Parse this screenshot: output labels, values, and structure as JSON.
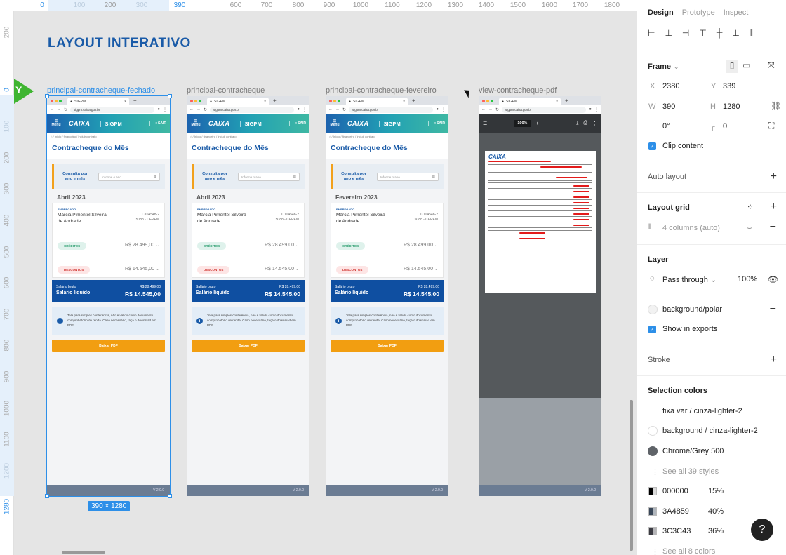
{
  "ruler": {
    "top": [
      "0",
      "100",
      "200",
      "300",
      "390",
      "600",
      "700",
      "800",
      "900",
      "1000",
      "1100",
      "1200",
      "1300",
      "1400",
      "1500",
      "1600",
      "1700",
      "1800"
    ],
    "left": [
      "200",
      "0",
      "100",
      "200",
      "300",
      "400",
      "500",
      "600",
      "700",
      "800",
      "900",
      "1000",
      "1100",
      "1200",
      "1280"
    ]
  },
  "canvas": {
    "title": "LAYOUT INTERATIVO",
    "flag_letter": "Y",
    "size_badge": "390 × 1280"
  },
  "frames": [
    {
      "label": "principal-contracheque-fechado",
      "month": "Abril 2023"
    },
    {
      "label": "principal-contracheque",
      "month": "Abril 2023"
    },
    {
      "label": "principal-contracheque-fevereiro",
      "month": "Fevereiro 2023"
    }
  ],
  "pdf_frame": {
    "label": "view-contracheque-pdf",
    "zoom": "100%",
    "logo": "CAIXA"
  },
  "mobile": {
    "tab_title": "SIGPM",
    "url": "sigpm.caixa.gov.br",
    "menu": "Menu",
    "brand": "CAIXA",
    "app": "SIGPM",
    "logout": "SAIR",
    "breadcrumb": "Início / financeiro / Incluir contrato",
    "heading": "Contracheque do Mês",
    "consulta_label": "Consulta por ano e mês",
    "consulta_placeholder": "Informe o ano",
    "employee_label": "EMPREGADO",
    "employee_name": "Márcia Pimentel Silveira de Andrade",
    "employee_code": "C104548-2",
    "employee_unit": "5088 - CEPEM",
    "creditos_label": "CRÉDITOS",
    "creditos_value": "R$ 28.499,00",
    "descontos_label": "DESCONTOS",
    "descontos_value": "R$ 14.545,00",
    "gross_label": "Salário bruto",
    "gross_value": "R$ 28.499,00",
    "net_label": "Salário líquido",
    "net_value": "R$ 14.545,00",
    "info_text": "Tela para simples conferência, não é válido como documento comprobatório de renda. Caso necessário, faça o download em PDF.",
    "pdf_button": "Baixar PDF",
    "version": "V 2.0.0"
  },
  "panel": {
    "tabs": [
      "Design",
      "Prototype",
      "Inspect"
    ],
    "frame_title": "Frame",
    "x_label": "X",
    "x_value": "2380",
    "y_label": "Y",
    "y_value": "339",
    "w_label": "W",
    "w_value": "390",
    "h_label": "H",
    "h_value": "1280",
    "rotation": "0°",
    "radius": "0",
    "clip_content": "Clip content",
    "auto_layout": "Auto layout",
    "layout_grid": "Layout grid",
    "grid_value": "4 columns (auto)",
    "layer": "Layer",
    "blend": "Pass through",
    "opacity": "100%",
    "fill_name": "background/polar",
    "show_exports": "Show in exports",
    "stroke": "Stroke",
    "selection_colors": "Selection colors",
    "colors": [
      {
        "name": "fixa var / cinza-lighter-2",
        "hex": "#e6e6e6"
      },
      {
        "name": "background / cinza-lighter-2",
        "hex": "#f2f2f2"
      },
      {
        "name": "Chrome/Grey 500",
        "hex": "#5f6368"
      }
    ],
    "see_all_styles": "See all 39 styles",
    "hex_colors": [
      {
        "hex": "000000",
        "opacity": "15%",
        "color": "#000000"
      },
      {
        "hex": "3A4859",
        "opacity": "40%",
        "color": "#3A4859"
      },
      {
        "hex": "3C3C43",
        "opacity": "36%",
        "color": "#3C3C43"
      }
    ],
    "see_all_colors": "See all 8 colors",
    "help": "?"
  }
}
